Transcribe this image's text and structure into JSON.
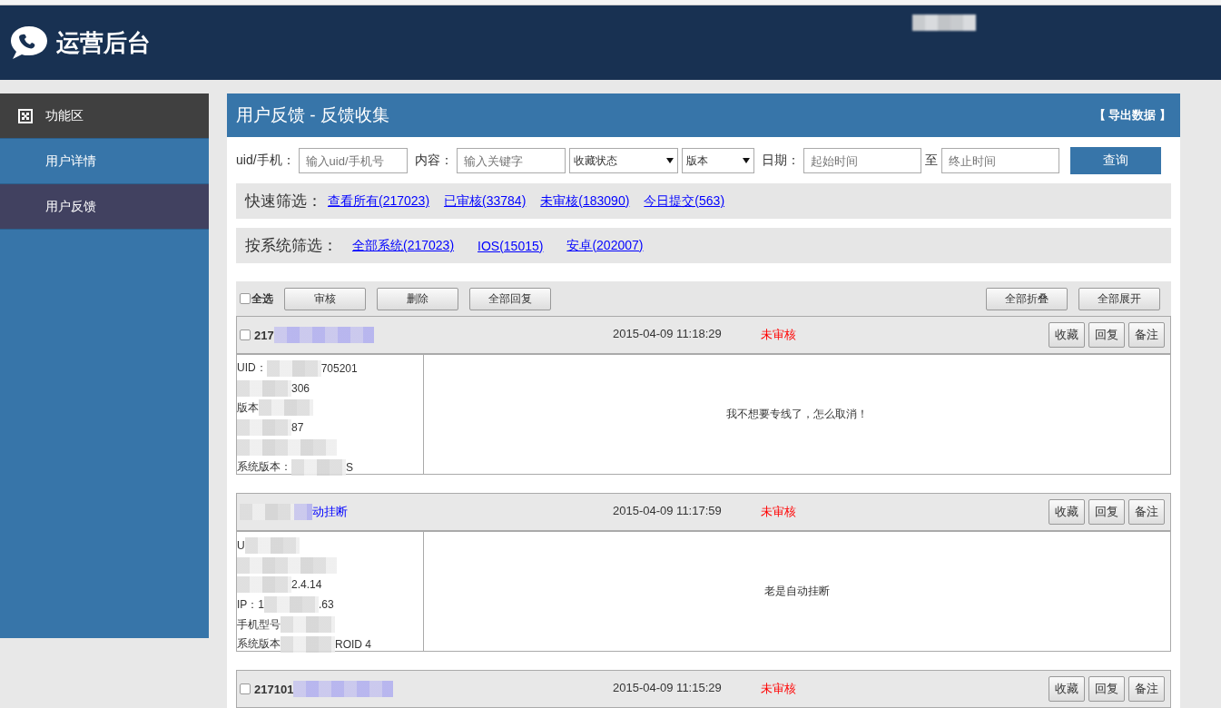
{
  "header": {
    "title": "运营后台"
  },
  "sidebar": {
    "items": [
      {
        "kind": "heading",
        "label": "功能区",
        "selected": false
      },
      {
        "kind": "link",
        "label": "用户详情",
        "selected": false
      },
      {
        "kind": "link",
        "label": "用户反馈",
        "selected": true
      }
    ]
  },
  "panel": {
    "title": "用户反馈 - 反馈收集",
    "export": "【 导出数据 】"
  },
  "filters": {
    "uid_label": "uid/手机：",
    "uid_placeholder": "输入uid/手机号",
    "content_label": "内容：",
    "content_placeholder": "输入关键字",
    "fav_select": "收藏状态",
    "version_select": "版本",
    "date_label": "日期：",
    "start_placeholder": "起始时间",
    "to": "至",
    "end_placeholder": "终止时间",
    "query": "查询"
  },
  "quick_filter": {
    "label": "快速筛选：",
    "links": [
      "查看所有(217023)",
      "已审核(33784)",
      "未审核(183090)",
      "今日提交(563)"
    ]
  },
  "system_filter": {
    "label": "按系统筛选：",
    "links": [
      "全部系统(217023)",
      "IOS(15015)",
      "安卓(202007)"
    ]
  },
  "toolbar": {
    "select_all": {
      "label": "全选",
      "checked": false
    },
    "left_buttons": [
      "审核",
      "删除",
      "全部回复"
    ],
    "right_buttons": [
      "全部折叠",
      "全部展开"
    ]
  },
  "feedback": [
    {
      "checked": false,
      "id": "217",
      "date": "2015-04-09 11:18:29",
      "status": "未审核",
      "actions": [
        "收藏",
        "回复",
        "备注"
      ],
      "message": "我不想要专线了，怎么取消！",
      "info": [
        {
          "prefix": "UID：",
          "suffix": "705201",
          "redacted": true
        },
        {
          "suffix": "306",
          "redacted": true
        },
        {
          "prefix": "版本",
          "redacted": true
        },
        {
          "suffix": "87",
          "redacted": true
        },
        {
          "redacted": true
        },
        {
          "prefix": "系统版本：",
          "suffix": "S",
          "redacted": true
        }
      ]
    },
    {
      "title": "动挂断",
      "date": "2015-04-09 11:17:59",
      "status": "未审核",
      "actions": [
        "收藏",
        "回复",
        "备注"
      ],
      "message": "老是自动挂断",
      "info": [
        {
          "prefix": "U",
          "redacted": true
        },
        {
          "redacted": true
        },
        {
          "suffix": "2.4.14",
          "redacted": true
        },
        {
          "prefix": "IP：1",
          "suffix": ".63",
          "redacted": true
        },
        {
          "prefix": "手机型号",
          "redacted": true
        },
        {
          "prefix": "系统版本",
          "suffix": "ROID 4",
          "redacted": true
        }
      ]
    },
    {
      "checked": false,
      "id": "217101",
      "date": "2015-04-09 11:15:29",
      "status": "未审核",
      "actions": [
        "收藏",
        "回复",
        "备注"
      ]
    }
  ]
}
